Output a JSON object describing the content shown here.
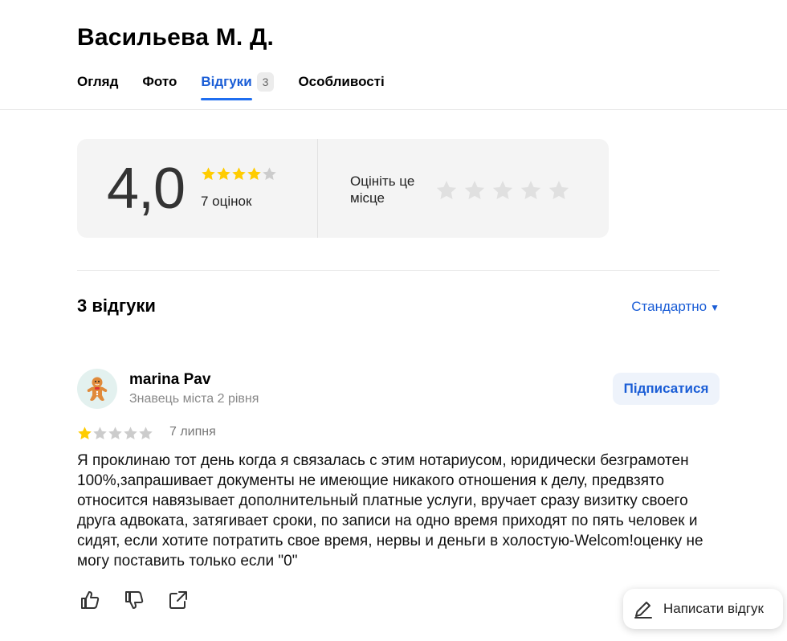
{
  "header": {
    "title": "Васильева М. Д.",
    "tabs": [
      {
        "label": "Огляд"
      },
      {
        "label": "Фото"
      },
      {
        "label": "Відгуки",
        "count": "3",
        "active": true
      },
      {
        "label": "Особливості"
      }
    ]
  },
  "rating": {
    "value": "4,0",
    "stars_filled": 4,
    "stars_total": 5,
    "count_label": "7 оцінок",
    "rate_label": "Оцініть це місце"
  },
  "reviews": {
    "title": "3 відгуки",
    "sort_label": "Стандартно",
    "items": [
      {
        "author": "marina Pav",
        "level": "Знавець міста 2 рівня",
        "subscribe_label": "Підписатися",
        "stars": 1,
        "date": "7 липня",
        "text": "Я проклинаю тот день когда я связалась с этим нотариусом, юридически безграмотен 100%,запрашивает документы не имеющие никакого отношения к делу, предвзято относится навязывает дополнительный платные услуги, вручает сразу визитку своего друга адвоката, затягивает сроки, по записи на одно время приходят по пять человек и сидят, если хотите потратить свое время, нервы и деньги в холостую-Welcom!оценку не могу поставить только если \"0\""
      }
    ]
  },
  "write_review_label": "Написати відгук",
  "colors": {
    "accent": "#1a5dd6",
    "star_filled": "#fc0",
    "star_empty": "#ccc",
    "rate_star_empty": "#e0e0e0"
  }
}
